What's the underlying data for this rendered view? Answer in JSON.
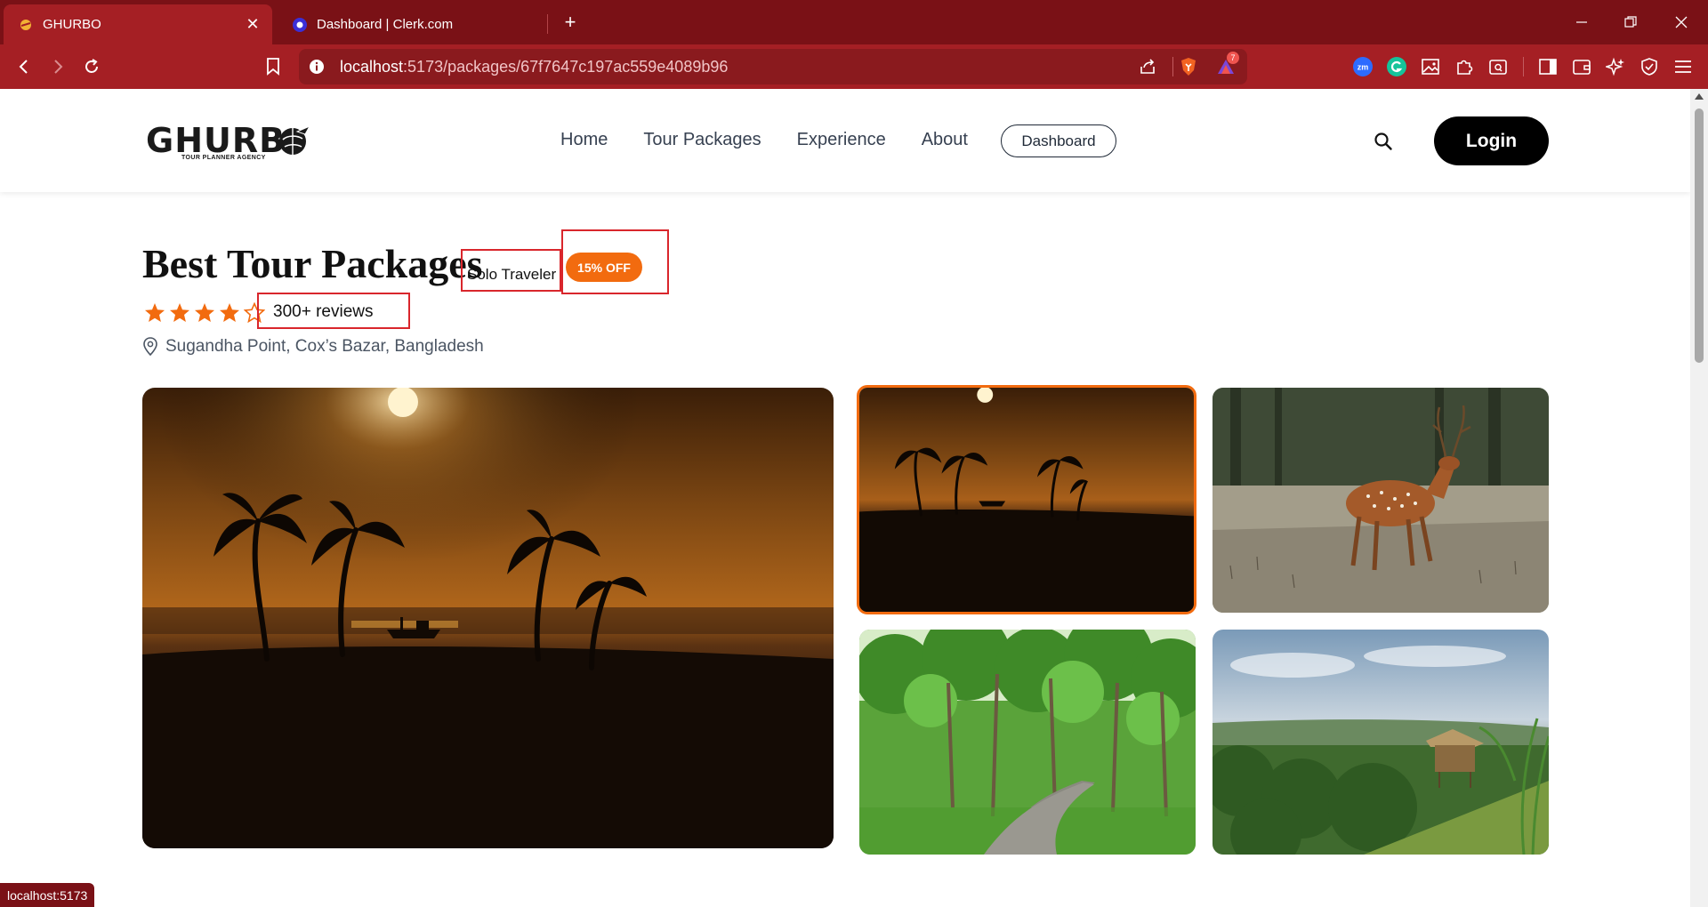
{
  "browser": {
    "tabs": [
      {
        "title": "GHURBO",
        "active": true
      },
      {
        "title": "Dashboard | Clerk.com",
        "active": false
      }
    ],
    "url_host": "localhost",
    "url_rest": ":5173/packages/67f7647c197ac559e4089b96",
    "notification_badge": "7",
    "status_text": "localhost:5173"
  },
  "site": {
    "logo_word": "GHURB",
    "logo_tagline": "TOUR PLANNER AGENCY",
    "nav": [
      "Home",
      "Tour Packages",
      "Experience",
      "About"
    ],
    "dashboard_label": "Dashboard",
    "login_label": "Login"
  },
  "package": {
    "title": "Best Tour Packages",
    "traveler_type": "Solo Traveler",
    "discount": "15% OFF",
    "rating": 4,
    "rating_max": 5,
    "reviews": "300+ reviews",
    "location": "Sugandha Point, Cox’s Bazar, Bangladesh",
    "gallery": {
      "main": "sunset-beach-palms",
      "thumbnails": [
        "sunset-beach-palms",
        "spotted-deer",
        "forest-path",
        "hill-hut-view"
      ],
      "selected_index": 0
    }
  },
  "colors": {
    "tab_bar": "#7a1116",
    "toolbar": "#a51f24",
    "accent_orange": "#f26b0f",
    "annotation_red": "#d9262c",
    "button_black": "#000000"
  }
}
